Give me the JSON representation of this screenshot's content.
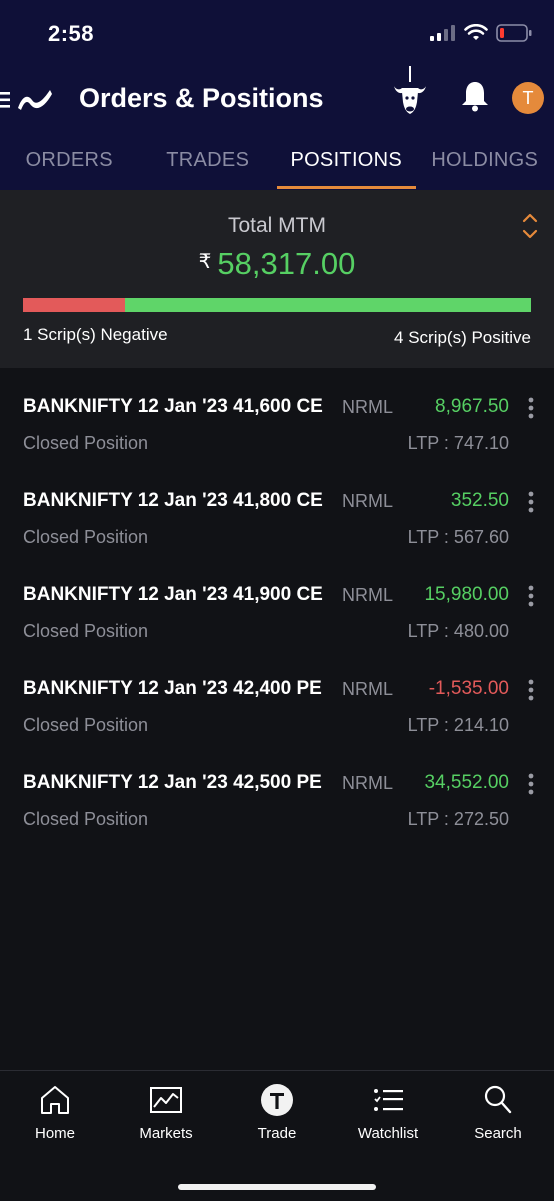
{
  "status_bar": {
    "time": "2:58"
  },
  "header": {
    "title": "Orders & Positions",
    "avatar_letter": "T"
  },
  "tabs": [
    {
      "label": "ORDERS"
    },
    {
      "label": "TRADES"
    },
    {
      "label": "POSITIONS"
    },
    {
      "label": "HOLDINGS"
    }
  ],
  "active_tab": "POSITIONS",
  "mtm": {
    "label": "Total MTM",
    "currency": "₹",
    "value": "58,317.00",
    "negative_text": "1 Scrip(s) Negative",
    "positive_text": "4 Scrip(s) Positive",
    "negative_count": 1,
    "positive_count": 4
  },
  "positions": [
    {
      "name": "BANKNIFTY 12 Jan '23 41,600 CE",
      "product": "NRML",
      "pnl": "8,967.50",
      "status": "Closed Position",
      "ltp": "LTP : 747.10"
    },
    {
      "name": "BANKNIFTY 12 Jan '23 41,800 CE",
      "product": "NRML",
      "pnl": "352.50",
      "status": "Closed Position",
      "ltp": "LTP : 567.60"
    },
    {
      "name": "BANKNIFTY 12 Jan '23 41,900 CE",
      "product": "NRML",
      "pnl": "15,980.00",
      "status": "Closed Position",
      "ltp": "LTP : 480.00"
    },
    {
      "name": "BANKNIFTY 12 Jan '23 42,400 PE",
      "product": "NRML",
      "pnl": "-1,535.00",
      "status": "Closed Position",
      "ltp": "LTP : 214.10"
    },
    {
      "name": "BANKNIFTY 12 Jan '23 42,500 PE",
      "product": "NRML",
      "pnl": "34,552.00",
      "status": "Closed Position",
      "ltp": "LTP : 272.50"
    }
  ],
  "bottom_nav": [
    {
      "label": "Home",
      "icon": "home-icon"
    },
    {
      "label": "Markets",
      "icon": "markets-chart-icon"
    },
    {
      "label": "Trade",
      "icon": "trade-icon"
    },
    {
      "label": "Watchlist",
      "icon": "watchlist-icon"
    },
    {
      "label": "Search",
      "icon": "search-icon"
    }
  ],
  "colors": {
    "header_bg": "#0f1038",
    "accent": "#e58a3b",
    "positive": "#56cf63",
    "negative": "#e35a5a"
  }
}
